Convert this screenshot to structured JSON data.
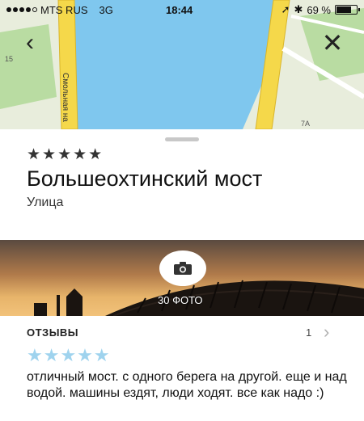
{
  "status_bar": {
    "carrier": "MTS RUS",
    "network": "3G",
    "time": "18:44",
    "battery": "69 %",
    "battery_level": 0.69,
    "signal_bars_filled": 4,
    "icons": [
      "signal-dots-icon",
      "location-arrow-icon",
      "bluetooth-icon",
      "battery-icon"
    ]
  },
  "map": {
    "back_icon": "‹",
    "close_icon": "✕",
    "street_label": "Смольная на",
    "label_a": "15",
    "label_b": "7А",
    "colors": {
      "water": "#7fc7ee",
      "land": "#e8eddc",
      "park": "#b9dca2",
      "road": "#f5d84a"
    }
  },
  "place": {
    "rating_stars": "★★★★★",
    "title": "Большеохтинский мост",
    "type": "Улица"
  },
  "photo": {
    "label": "30 ФОТО",
    "icon": "camera-icon"
  },
  "reviews": {
    "header": "ОТЗЫВЫ",
    "count": "1",
    "chevron": "›",
    "stars": "★★★★★",
    "text": "отличный мост. с одного берега на другой. еще и над водой. машины ездят, люди ходят. все как надо :)",
    "star_color": "#9fd3ee"
  }
}
